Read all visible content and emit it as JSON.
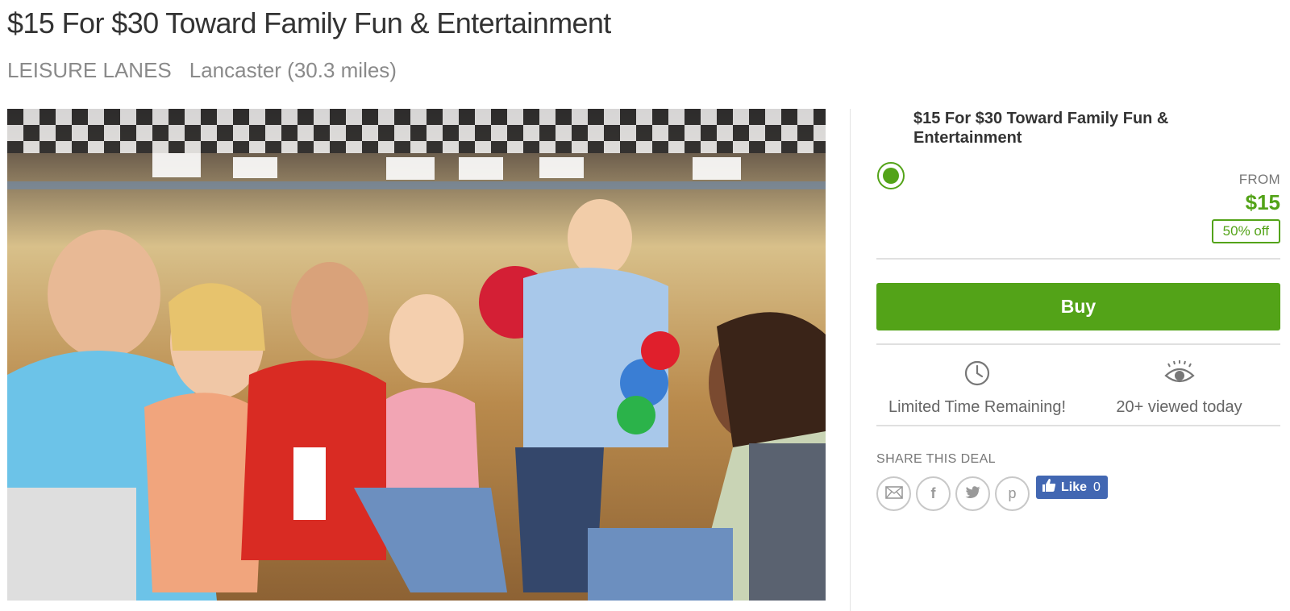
{
  "deal": {
    "title": "$15 For $30 Toward Family Fun & Entertainment",
    "merchant": "LEISURE LANES",
    "location": "Lancaster (30.3 miles)"
  },
  "option": {
    "title": "$15 For $30 Toward Family Fun & Entertainment",
    "selected": true,
    "from_label": "FROM",
    "price": "$15",
    "discount": "50% off"
  },
  "buy": {
    "label": "Buy"
  },
  "stats": {
    "time": {
      "icon": "clock-icon",
      "label": "Limited Time Remaining!"
    },
    "views": {
      "icon": "eye-icon",
      "label": "20+ viewed today"
    }
  },
  "share": {
    "label": "SHARE THIS DEAL",
    "buttons": [
      {
        "icon": "mail-icon"
      },
      {
        "icon": "facebook-icon",
        "glyph": "f"
      },
      {
        "icon": "twitter-icon"
      },
      {
        "icon": "pinterest-icon",
        "glyph": "p"
      }
    ],
    "like": {
      "label": "Like",
      "count": "0"
    }
  },
  "colors": {
    "accent_green": "#53a318",
    "facebook_blue": "#4267b2",
    "text_dark": "#333333",
    "text_muted": "#8a8a8a"
  }
}
